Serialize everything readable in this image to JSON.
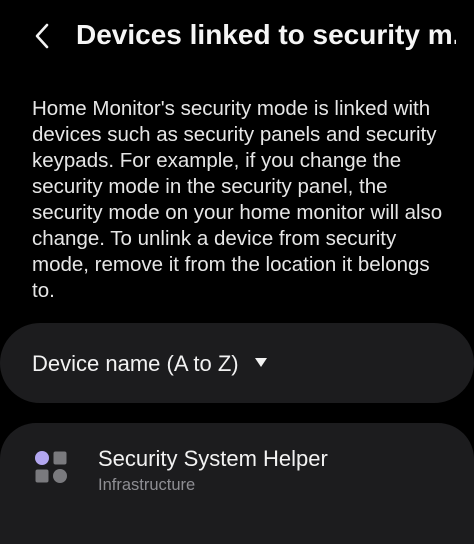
{
  "header": {
    "title": "Devices linked to security m...",
    "back_icon": "chevron-left-icon"
  },
  "description": "Home Monitor's security mode is linked with devices such as security panels and security keypads. For example, if you change the security mode in the security panel, the security mode on your home monitor will also change. To unlink a device from security mode, remove it from the location it belongs to.",
  "sort": {
    "label": "Device name (A to Z)",
    "icon": "caret-down-icon"
  },
  "devices": [
    {
      "name": "Security System Helper",
      "category": "Infrastructure",
      "icon": "device-grid-icon"
    }
  ],
  "colors": {
    "background": "#000000",
    "card": "#1c1c1e",
    "text_primary": "#f2f2f2",
    "text_secondary": "#8e8e93",
    "icon_accent": "#b3a7f0",
    "icon_gray": "#7a7a7e"
  }
}
